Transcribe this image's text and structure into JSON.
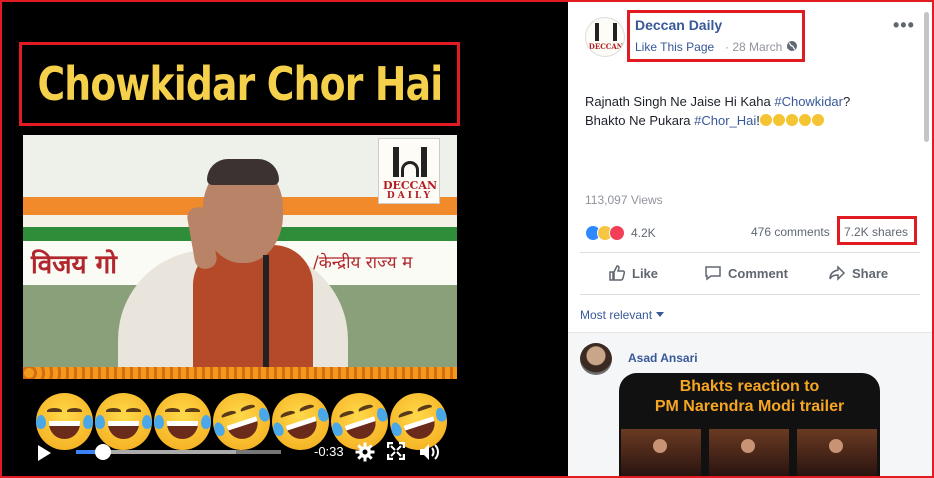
{
  "video": {
    "headline": "Chowkidar Chor Hai",
    "banner_hindi": "विजय गो",
    "banner_hindi_right": "/केन्द्रीय राज्य म",
    "watermark_line1": "DECCAN",
    "watermark_line2": "DAILY",
    "emoji_count": 7,
    "time_remaining": "-0:33",
    "progress": 0.13,
    "buffered": 0.78
  },
  "post": {
    "page_name": "Deccan Daily",
    "like_page": "Like This Page",
    "date": "· 28 March ·",
    "text_line1_prefix": "Rajnath Singh Ne Jaise Hi Kaha ",
    "hashtag1": "#Chowkidar",
    "text_line1_suffix": "?",
    "text_line2_prefix": "Bhakto Ne Pukara ",
    "hashtag2": "#Chor_Hai",
    "text_line2_suffix": "!",
    "views": "113,097 Views",
    "reaction_count": "4.2K",
    "comments": "476 comments",
    "shares": "7.2K shares",
    "actions": {
      "like": "Like",
      "comment": "Comment",
      "share": "Share"
    },
    "sort_label": "Most relevant",
    "comment": {
      "author": "Asad Ansari",
      "image_title_line1": "Bhakts reaction to",
      "image_title_line2": "PM Narendra Modi trailer"
    }
  },
  "colors": {
    "highlight_border": "#e01b22",
    "headline": "#f5d04a",
    "link": "#385898",
    "progress": "#3b82f6"
  }
}
